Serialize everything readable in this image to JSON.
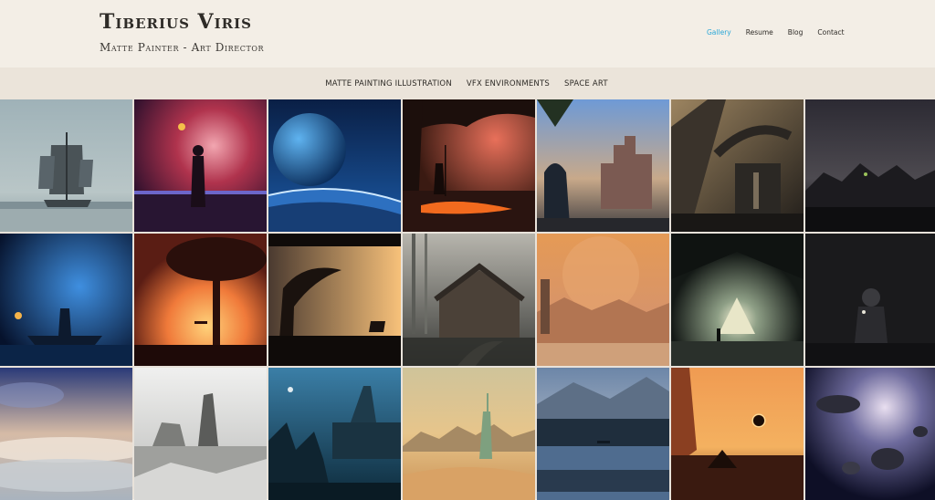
{
  "site": {
    "title": "Tiberius Viris",
    "subtitle": "Matte Painter - Art Director"
  },
  "nav": {
    "items": [
      {
        "label": "Gallery",
        "active": true
      },
      {
        "label": "Resume",
        "active": false
      },
      {
        "label": "Blog",
        "active": false
      },
      {
        "label": "Contact",
        "active": false
      }
    ]
  },
  "categories": [
    {
      "label": "MATTE PAINTING ILLUSTRATION"
    },
    {
      "label": "VFX ENVIRONMENTS"
    },
    {
      "label": "SPACE ART"
    }
  ],
  "colors": {
    "background": "#f3eee6",
    "category_bar": "#ebe4da",
    "active_link": "#2aa7d8",
    "text": "#2e2b27"
  },
  "gallery": {
    "tiles": [
      {
        "subject": "pirate-ship-in-fog"
      },
      {
        "subject": "man-before-red-nebula"
      },
      {
        "subject": "blue-planet-horizon"
      },
      {
        "subject": "warrior-at-lava-cave"
      },
      {
        "subject": "hooded-figure-castle-city"
      },
      {
        "subject": "sci-fi-machinery"
      },
      {
        "subject": "dark-alien-city"
      },
      {
        "subject": "fisherman-boat-night"
      },
      {
        "subject": "tree-swing-sunset"
      },
      {
        "subject": "rider-under-dead-tree"
      },
      {
        "subject": "old-cabin-forest"
      },
      {
        "subject": "desert-planet-statue"
      },
      {
        "subject": "glowing-portal-tunnel"
      },
      {
        "subject": "astronaut-in-dark"
      },
      {
        "subject": "above-the-clouds"
      },
      {
        "subject": "snowy-rock-spires"
      },
      {
        "subject": "castle-ruins-blue-forest"
      },
      {
        "subject": "statue-of-liberty-desert"
      },
      {
        "subject": "lake-reflection-birds"
      },
      {
        "subject": "couple-watching-eclipse"
      },
      {
        "subject": "asteroid-nebula"
      }
    ]
  }
}
